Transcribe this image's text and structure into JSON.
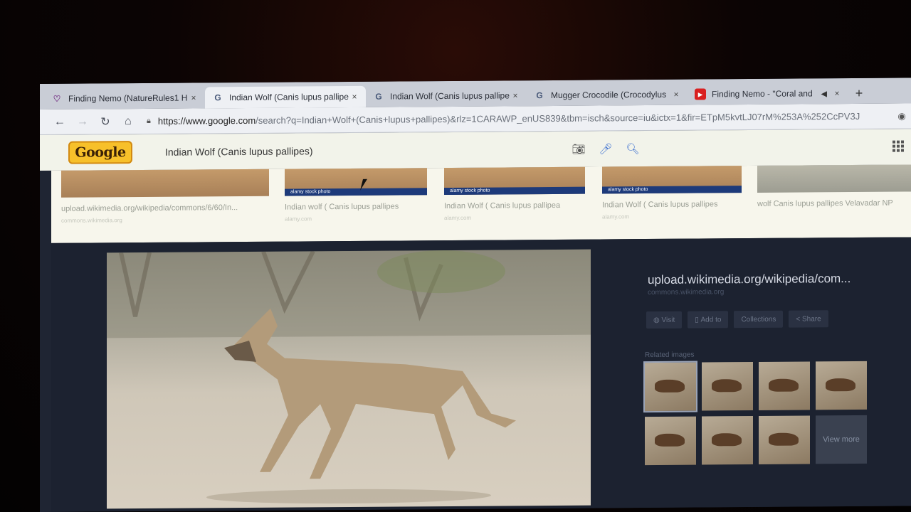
{
  "tabs": [
    {
      "title": "Finding Nemo (NatureRules1 H",
      "icon": "heart-icon",
      "active": false
    },
    {
      "title": "Indian Wolf (Canis lupus pallipe",
      "icon": "google-icon",
      "active": true
    },
    {
      "title": "Indian Wolf (Canis lupus pallipe",
      "icon": "google-icon",
      "active": false
    },
    {
      "title": "Mugger Crocodile (Crocodylus",
      "icon": "google-icon",
      "active": false
    },
    {
      "title": "Finding Nemo - \"Coral and",
      "icon": "youtube-icon",
      "active": false
    }
  ],
  "tab_close_glyph": "×",
  "new_tab_glyph": "+",
  "address": {
    "host": "https://www.google.com",
    "path": "/search?q=Indian+Wolf+(Canis+lupus+pallipes)&rlz=1CARAWP_enUS839&tbm=isch&source=iu&ictx=1&fir=ETpM5kvtLJ07rM%253A%252CcPV3J"
  },
  "google": {
    "logo_text": "Google",
    "query": "Indian Wolf (Canis lupus pallipes)"
  },
  "results": [
    {
      "caption": "upload.wikimedia.org/wikipedia/commons/6/60/In...",
      "source": "commons.wikimedia.org",
      "stock": ""
    },
    {
      "caption": "Indian wolf ( Canis lupus pallipes",
      "source": "alamy.com",
      "stock": "alamy stock photo"
    },
    {
      "caption": "Indian Wolf ( Canis lupus pallipea",
      "source": "alamy.com",
      "stock": "alamy stock photo"
    },
    {
      "caption": "Indian Wolf ( Canis lupus pallipes",
      "source": "alamy.com",
      "stock": "alamy stock photo"
    },
    {
      "caption": "wolf Canis lupus pallipes Velavadar NP",
      "source": "",
      "stock": ""
    }
  ],
  "preview": {
    "title": "upload.wikimedia.org/wikipedia/com...",
    "subtitle": "commons.wikimedia.org",
    "actions": {
      "visit": "Visit",
      "add_to": "Add to",
      "collections": "Collections",
      "share": "Share"
    },
    "related_label": "Related images",
    "view_more": "View more"
  }
}
